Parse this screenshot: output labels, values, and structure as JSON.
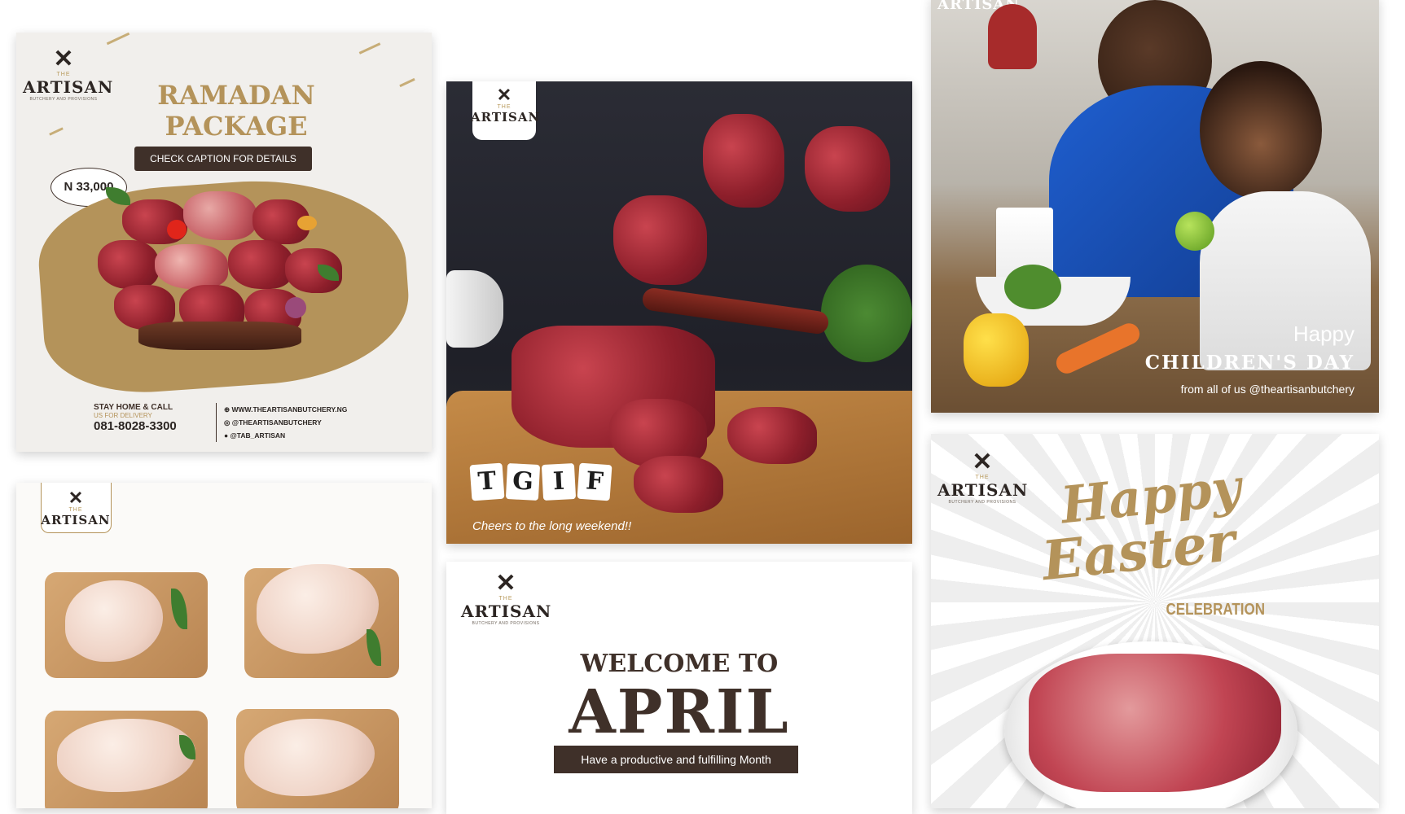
{
  "colors": {
    "gold": "#b4935a",
    "dark_brown": "#3f3029",
    "meat_red": "#a8303c",
    "slate": "#2b2c35"
  },
  "brand": {
    "the": "THE",
    "name": "ARTISAN",
    "tagline": "BUTCHERY AND PROVISIONS"
  },
  "ramadan": {
    "title_line1": "RAMADAN",
    "title_line2": "PACKAGE",
    "button_label": "CHECK CAPTION FOR DETAILS",
    "price": "N 33,000",
    "stay_home": "STAY HOME & CALL",
    "us_delivery": "US FOR DELIVERY",
    "phone": "081-8028-3300",
    "website": "WWW.THEARTISANBUTCHERY.NG",
    "instagram": "@THEARTISANBUTCHERY",
    "twitter": "@TAB_ARTISAN",
    "icon_web": "globe-icon",
    "icon_instagram": "instagram-icon",
    "icon_twitter": "twitter-icon"
  },
  "tgif": {
    "letters": [
      "T",
      "G",
      "I",
      "F"
    ],
    "subtitle": "Cheers to the long weekend!!"
  },
  "childrens_day": {
    "line1": "Happy",
    "line2": "CHILDREN'S DAY",
    "line3": "from all of us @theartisanbutchery"
  },
  "april": {
    "line1": "WELCOME TO",
    "line2": "APRIL",
    "banner": "Have a productive and fulfilling Month"
  },
  "easter": {
    "line1": "Happy",
    "line2": "Easter",
    "line3": "CELEBRATION"
  }
}
